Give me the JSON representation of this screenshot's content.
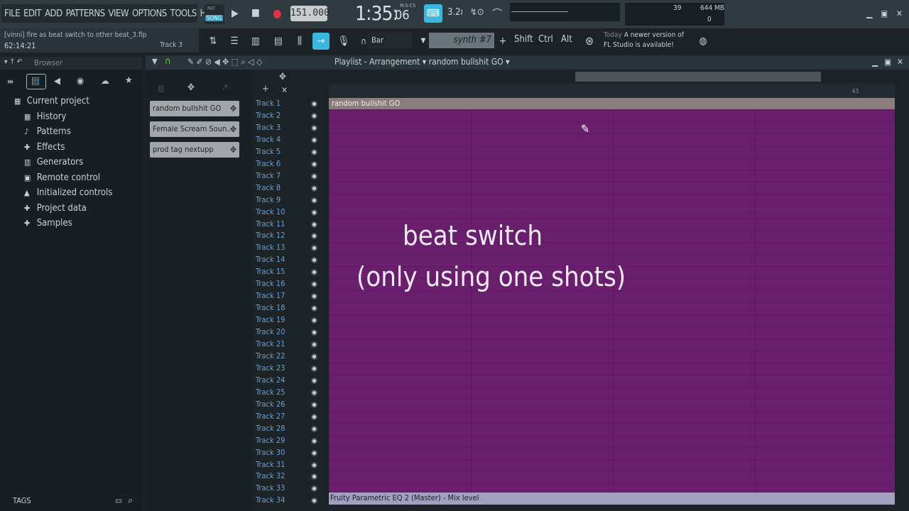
{
  "menu": [
    "FILE",
    "EDIT",
    "ADD",
    "PATTERNS",
    "VIEW",
    "OPTIONS",
    "TOOLS",
    "HELP"
  ],
  "transport": {
    "pat_label": "PAT",
    "song_label": "SONG",
    "tempo": "151.000",
    "time_main": "1:35:",
    "time_sub": "06",
    "time_format": "M:S:CS"
  },
  "hint_bar": {
    "text": "[vinni] fire as beat switch to other beat_3.flp",
    "time": "62:14:21",
    "track": "Track 3"
  },
  "monitor": {
    "cpu": "39",
    "memory": "644 MB",
    "polyphony": "0"
  },
  "toolbar2": {
    "snap": "Bar",
    "instrument": "synth #7",
    "keys": [
      "Shift",
      "Ctrl",
      "Alt"
    ],
    "news_date": "Today",
    "news_line1": "A newer version of",
    "news_line2": "FL Studio is available!"
  },
  "browser": {
    "title": "Browser",
    "items": [
      {
        "label": "Current project",
        "icon": "project-icon"
      },
      {
        "label": "History",
        "icon": "history-icon"
      },
      {
        "label": "Patterns",
        "icon": "note-icon"
      },
      {
        "label": "Effects",
        "icon": "plug-icon"
      },
      {
        "label": "Generators",
        "icon": "keyboard-icon"
      },
      {
        "label": "Remote control",
        "icon": "remote-icon"
      },
      {
        "label": "Initialized controls",
        "icon": "lock-icon"
      },
      {
        "label": "Project data",
        "icon": "plug-icon"
      },
      {
        "label": "Samples",
        "icon": "wave-icon"
      }
    ],
    "tags_label": "TAGS"
  },
  "playlist": {
    "title": "Playlist - Arrangement",
    "pattern_name": "random bullshit GO",
    "timeline_marker": "63",
    "clips": [
      "random bullshit GO",
      "Female Scream Soun...",
      "prod tag nextupp"
    ],
    "tracks": [
      "Track 1",
      "Track 2",
      "Track 3",
      "Track 4",
      "Track 5",
      "Track 6",
      "Track 7",
      "Track 8",
      "Track 9",
      "Track 10",
      "Track 11",
      "Track 12",
      "Track 13",
      "Track 14",
      "Track 15",
      "Track 16",
      "Track 17",
      "Track 18",
      "Track 19",
      "Track 20",
      "Track 21",
      "Track 22",
      "Track 23",
      "Track 24",
      "Track 25",
      "Track 26",
      "Track 27",
      "Track 28",
      "Track 29",
      "Track 30",
      "Track 31",
      "Track 32",
      "Track 33",
      "Track 34"
    ],
    "pattern_block": "random bullshit GO",
    "automation_clip": "Fruity Parametric EQ 2 (Master) - Mix level",
    "overlay_line1": "beat switch",
    "overlay_line2": "(only using one shots)"
  }
}
